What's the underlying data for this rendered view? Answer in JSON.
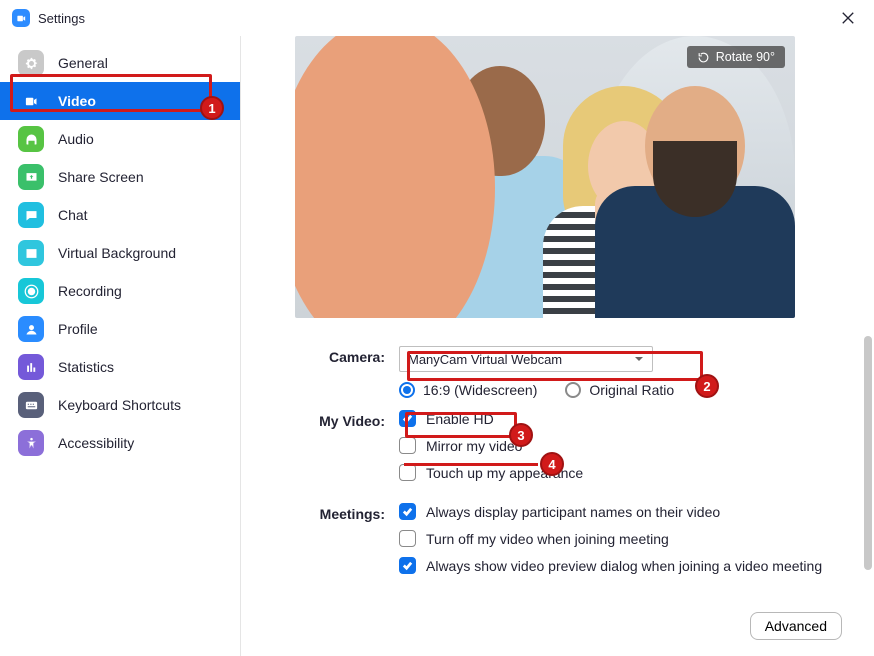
{
  "window": {
    "title": "Settings"
  },
  "sidebar": {
    "items": [
      {
        "label": "General",
        "icon": "gear",
        "color": "#c9c9c9"
      },
      {
        "label": "Video",
        "icon": "video",
        "color": "#0E71EB",
        "active": true
      },
      {
        "label": "Audio",
        "icon": "audio",
        "color": "#57c443"
      },
      {
        "label": "Share Screen",
        "icon": "share",
        "color": "#3ac06a"
      },
      {
        "label": "Chat",
        "icon": "chat",
        "color": "#20bfe0"
      },
      {
        "label": "Virtual Background",
        "icon": "vbg",
        "color": "#2fc6de"
      },
      {
        "label": "Recording",
        "icon": "record",
        "color": "#17c7d8"
      },
      {
        "label": "Profile",
        "icon": "profile",
        "color": "#2a8cff"
      },
      {
        "label": "Statistics",
        "icon": "stats",
        "color": "#7459d9"
      },
      {
        "label": "Keyboard Shortcuts",
        "icon": "keyboard",
        "color": "#59607a"
      },
      {
        "label": "Accessibility",
        "icon": "a11y",
        "color": "#8c6fd9"
      }
    ]
  },
  "preview": {
    "rotate_label": "Rotate 90°"
  },
  "form": {
    "camera_label": "Camera:",
    "camera_value": "ManyCam Virtual Webcam",
    "ratio_169": "16:9 (Widescreen)",
    "ratio_orig": "Original Ratio",
    "my_video_label": "My Video:",
    "enable_hd": "Enable HD",
    "mirror": "Mirror my video",
    "touchup": "Touch up my appearance",
    "meetings_label": "Meetings:",
    "meet_names": "Always display participant names on their video",
    "meet_offvideo": "Turn off my video when joining meeting",
    "meet_preview": "Always show video preview dialog when joining a video meeting",
    "advanced": "Advanced"
  },
  "annotations": {
    "n1": "1",
    "n2": "2",
    "n3": "3",
    "n4": "4"
  }
}
